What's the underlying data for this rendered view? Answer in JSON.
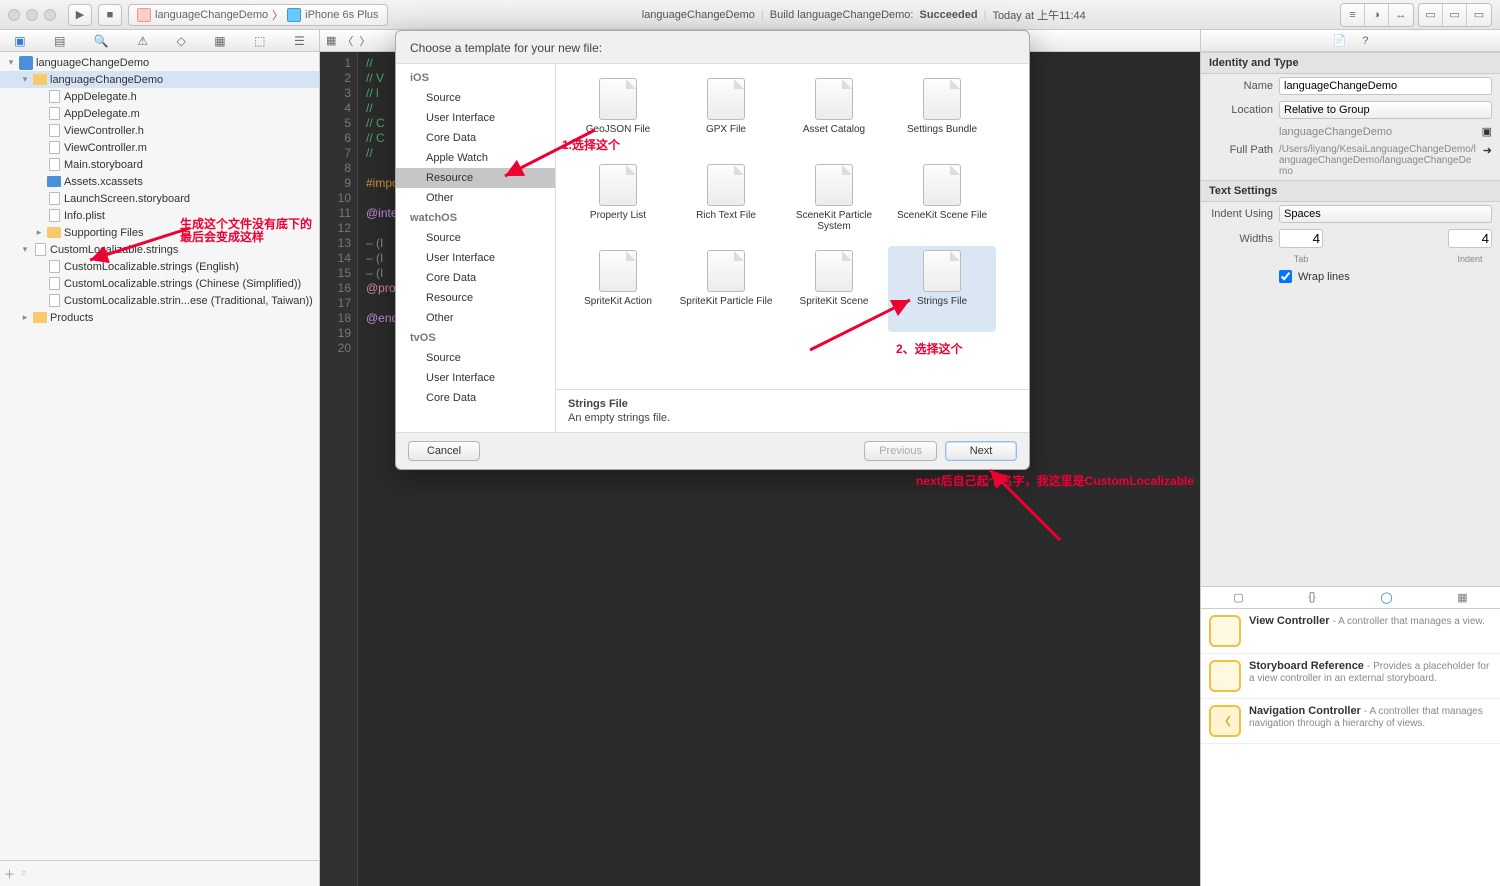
{
  "toolbar": {
    "scheme_name": "languageChangeDemo",
    "device": "iPhone 6s Plus",
    "status_project": "languageChangeDemo",
    "status_action": "Build languageChangeDemo:",
    "status_result": "Succeeded",
    "status_time": "Today at 上午11:44"
  },
  "navigator": {
    "items": [
      {
        "depth": 0,
        "icon": "proj",
        "label": "languageChangeDemo",
        "disc": "▾"
      },
      {
        "depth": 1,
        "icon": "folder-yellow",
        "label": "languageChangeDemo",
        "disc": "▾",
        "sel": true
      },
      {
        "depth": 2,
        "icon": "file",
        "label": "AppDelegate.h",
        "disc": ""
      },
      {
        "depth": 2,
        "icon": "file",
        "label": "AppDelegate.m",
        "disc": ""
      },
      {
        "depth": 2,
        "icon": "file",
        "label": "ViewController.h",
        "disc": ""
      },
      {
        "depth": 2,
        "icon": "file",
        "label": "ViewController.m",
        "disc": ""
      },
      {
        "depth": 2,
        "icon": "file",
        "label": "Main.storyboard",
        "disc": ""
      },
      {
        "depth": 2,
        "icon": "folder-blue",
        "label": "Assets.xcassets",
        "disc": ""
      },
      {
        "depth": 2,
        "icon": "file",
        "label": "LaunchScreen.storyboard",
        "disc": ""
      },
      {
        "depth": 2,
        "icon": "file",
        "label": "Info.plist",
        "disc": ""
      },
      {
        "depth": 2,
        "icon": "folder-yellow",
        "label": "Supporting Files",
        "disc": "▸"
      },
      {
        "depth": 1,
        "icon": "file",
        "label": "CustomLocalizable.strings",
        "disc": "▾"
      },
      {
        "depth": 2,
        "icon": "file",
        "label": "CustomLocalizable.strings (English)",
        "disc": ""
      },
      {
        "depth": 2,
        "icon": "file",
        "label": "CustomLocalizable.strings (Chinese (Simplified))",
        "disc": ""
      },
      {
        "depth": 2,
        "icon": "file",
        "label": "CustomLocalizable.strin...ese (Traditional, Taiwan))",
        "disc": ""
      },
      {
        "depth": 1,
        "icon": "folder-yellow",
        "label": "Products",
        "disc": "▸"
      }
    ]
  },
  "editor": {
    "lines": [
      {
        "n": "1",
        "html": "<span class='c-green'>//</span>"
      },
      {
        "n": "2",
        "html": "<span class='c-green'>//  V</span>"
      },
      {
        "n": "3",
        "html": "<span class='c-green'>//  l</span>"
      },
      {
        "n": "4",
        "html": "<span class='c-green'>//</span>"
      },
      {
        "n": "5",
        "html": "<span class='c-green'>//  C</span>"
      },
      {
        "n": "6",
        "html": "<span class='c-green'>//  C</span>"
      },
      {
        "n": "7",
        "html": "<span class='c-green'>//</span>"
      },
      {
        "n": "8",
        "html": ""
      },
      {
        "n": "9",
        "html": "<span class='c-orange'>#impo</span>"
      },
      {
        "n": "10",
        "html": ""
      },
      {
        "n": "11",
        "html": "<span class='c-purple'>@inte</span>"
      },
      {
        "n": "12",
        "html": ""
      },
      {
        "n": "13",
        "html": "<span class='br'>– (I</span>"
      },
      {
        "n": "14",
        "html": "<span class='br'>– (I</span>"
      },
      {
        "n": "15",
        "html": "<span class='br'>– (I</span>"
      },
      {
        "n": "16",
        "html": "<span class='c-pink'>@pro</span>"
      },
      {
        "n": "17",
        "html": ""
      },
      {
        "n": "18",
        "html": "<span class='c-purple'>@end</span>"
      },
      {
        "n": "19",
        "html": ""
      },
      {
        "n": "20",
        "html": ""
      }
    ]
  },
  "inspector": {
    "identity_title": "Identity and Type",
    "name_label": "Name",
    "name_value": "languageChangeDemo",
    "location_label": "Location",
    "location_value": "Relative to Group",
    "location_path": "languageChangeDemo",
    "fullpath_label": "Full Path",
    "fullpath_value": "/Users/liyang/KesaiLanguageChangeDemo/languageChangeDemo/languageChangeDemo",
    "text_title": "Text Settings",
    "indent_label": "Indent Using",
    "indent_value": "Spaces",
    "widths_label": "Widths",
    "tab_value": "4",
    "tab_label": "Tab",
    "indent_width": "4",
    "indent_width_label": "Indent",
    "wrap_label": "Wrap lines",
    "lib": [
      {
        "title": "View Controller",
        "desc": "- A controller that manages a view."
      },
      {
        "title": "Storyboard Reference",
        "desc": "- Provides a placeholder for a view controller in an external storyboard."
      },
      {
        "title": "Navigation Controller",
        "desc": "- A controller that manages navigation through a hierarchy of views."
      }
    ]
  },
  "modal": {
    "title": "Choose a template for your new file:",
    "categories": [
      {
        "head": "iOS"
      },
      {
        "item": "Source"
      },
      {
        "item": "User Interface"
      },
      {
        "item": "Core Data"
      },
      {
        "item": "Apple Watch"
      },
      {
        "item": "Resource",
        "sel": true
      },
      {
        "item": "Other"
      },
      {
        "head": "watchOS"
      },
      {
        "item": "Source"
      },
      {
        "item": "User Interface"
      },
      {
        "item": "Core Data"
      },
      {
        "item": "Resource"
      },
      {
        "item": "Other"
      },
      {
        "head": "tvOS"
      },
      {
        "item": "Source"
      },
      {
        "item": "User Interface"
      },
      {
        "item": "Core Data"
      }
    ],
    "templates": [
      {
        "label": "GeoJSON File"
      },
      {
        "label": "GPX File"
      },
      {
        "label": "Asset Catalog"
      },
      {
        "label": "Settings Bundle"
      },
      {
        "label": "Property List"
      },
      {
        "label": "Rich Text File"
      },
      {
        "label": "SceneKit Particle System"
      },
      {
        "label": "SceneKit Scene File"
      },
      {
        "label": "SpriteKit Action"
      },
      {
        "label": "SpriteKit Particle File"
      },
      {
        "label": "SpriteKit Scene"
      },
      {
        "label": "Strings File",
        "sel": true
      }
    ],
    "detail_title": "Strings File",
    "detail_desc": "An empty strings file.",
    "cancel": "Cancel",
    "previous": "Previous",
    "next": "Next"
  },
  "annotations": {
    "a1": "1.选择这个",
    "a2": "2、选择这个",
    "a3_l1": "生成这个文件没有底下的",
    "a3_l2": "最后会变成这样",
    "a4": "next后自己起个名字，我这里是CustomLocalizable"
  }
}
